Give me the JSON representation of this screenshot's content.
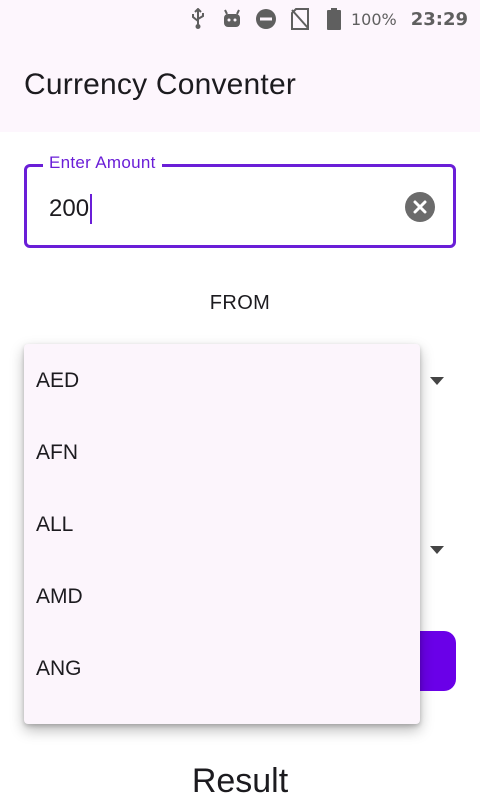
{
  "status_bar": {
    "battery_percent": "100%",
    "time": "23:29",
    "icons": [
      "usb-icon",
      "android-debug-icon",
      "do-not-disturb-icon",
      "no-sim-icon",
      "battery-icon"
    ]
  },
  "app_bar": {
    "title": "Currency Conventer"
  },
  "amount_field": {
    "label": "Enter Amount",
    "value": "200"
  },
  "from_label": "FROM",
  "dropdown": {
    "items": [
      "AED",
      "AFN",
      "ALL",
      "AMD",
      "ANG"
    ]
  },
  "result_label": "Result",
  "colors": {
    "accent": "#6a1ed7",
    "button": "#6a00e8",
    "surface": "#fdf6fd"
  }
}
